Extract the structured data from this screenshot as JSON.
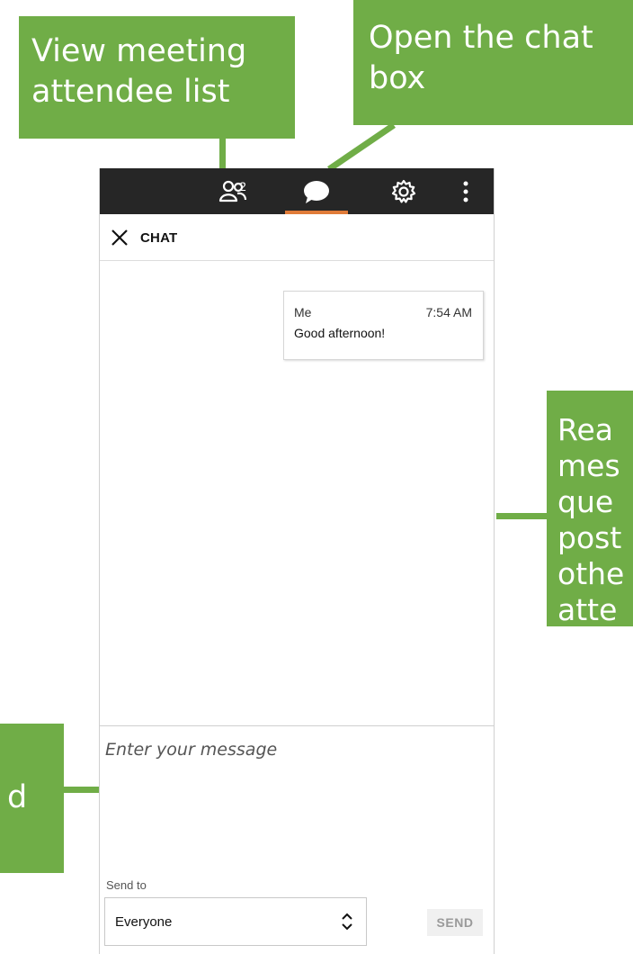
{
  "callouts": {
    "attendees": [
      "View meeting",
      "attendee list"
    ],
    "chat": [
      "Open the chat",
      "box"
    ],
    "read": [
      "Rea",
      "mes",
      "que",
      "post",
      "othe",
      "atte"
    ],
    "send": [
      "d"
    ]
  },
  "toolbar": {
    "attendee_count": "2"
  },
  "chat": {
    "title": "CHAT",
    "messages": [
      {
        "sender": "Me",
        "time": "7:54 AM",
        "text": "Good afternoon!"
      }
    ],
    "input_placeholder": "Enter your message",
    "send_to_label": "Send to",
    "recipient": "Everyone",
    "send_label": "SEND"
  },
  "colors": {
    "callout": "#70ad47",
    "topbar": "#262626",
    "active_tab": "#e07b39"
  },
  "icons": [
    "people-icon",
    "chat-bubble-icon",
    "gear-icon",
    "more-vertical-icon",
    "close-icon",
    "updown-arrows-icon"
  ]
}
